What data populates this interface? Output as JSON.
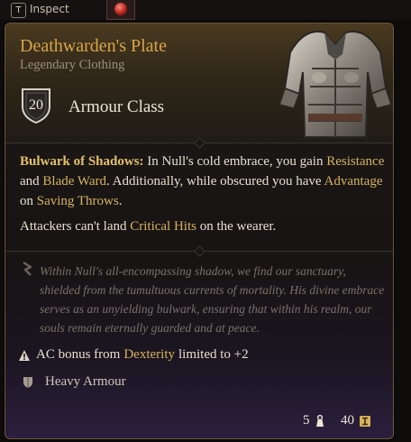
{
  "topbar": {
    "key": "T",
    "inspect_label": "Inspect"
  },
  "item": {
    "name": "Deathwarden's Plate",
    "rarity_type": "Legendary Clothing",
    "armour_class_value": "20",
    "armour_class_label": "Armour Class"
  },
  "ability": {
    "name": "Bulwark of Shadows:",
    "t1": " In Null's cold embrace, you gain",
    "k1": "Resistance",
    "t2": " and ",
    "k2": "Blade Ward",
    "t3": ". Additionally, while obscured you have ",
    "k3": "Advantage",
    "t4": " on ",
    "k4": "Saving Throws",
    "t5": "."
  },
  "passive": {
    "t1": "Attackers can't land ",
    "k1": "Critical Hits",
    "t2": " on the wearer."
  },
  "flavor_text": "Within Null's all-encompassing shadow, we find our sanctuary, shielded from the tumultuous currents of mortality. His divine embrace serves as an unyielding bulwark, ensuring that within his realm, our souls remain eternally guarded and at peace.",
  "notes": {
    "dex_t1": "AC bonus from ",
    "dex_k1": "Dexterity",
    "dex_t2": " limited to +2",
    "category": "Heavy Armour"
  },
  "footer": {
    "weight": "5",
    "value": "40"
  },
  "colors": {
    "title_gold": "#d9a54a",
    "keyword_gold": "#d8b35e",
    "flavor_gray": "#7a7169"
  },
  "icons": [
    "shield-icon",
    "quote-icon",
    "warning-icon",
    "armour-type-icon",
    "weight-icon",
    "gold-icon",
    "chest-armour-icon"
  ]
}
